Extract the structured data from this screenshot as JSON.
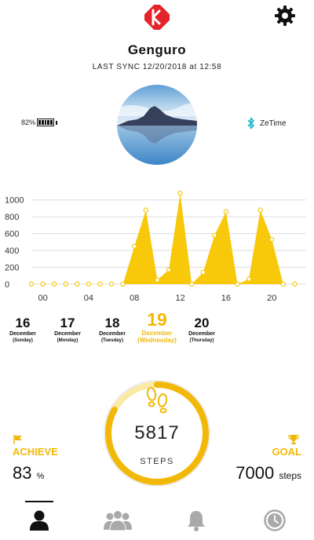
{
  "app": {
    "user_name": "Genguro",
    "last_sync": "LAST SYNC 12/20/2018 at 12:58",
    "brand_color": "#e5232b",
    "accent_color": "#f2b807"
  },
  "device": {
    "battery": "82%",
    "name": "ZeTime",
    "bluetooth_color": "#1cb5c8"
  },
  "chart_data": {
    "type": "area",
    "y_ticks": [
      "1000",
      "800",
      "600",
      "400",
      "200",
      "0"
    ],
    "x_ticks": [
      "00",
      "04",
      "08",
      "12",
      "16",
      "20"
    ],
    "ylim": [
      0,
      1100
    ],
    "xlim": [
      -1,
      23
    ],
    "x": [
      -1,
      0,
      1,
      2,
      3,
      4,
      5,
      6,
      7,
      8,
      9,
      10,
      11,
      12,
      13,
      14,
      15,
      16,
      17,
      18,
      19,
      20,
      21,
      22
    ],
    "values": [
      0,
      0,
      0,
      0,
      0,
      0,
      0,
      0,
      0,
      450,
      880,
      50,
      170,
      1080,
      0,
      140,
      580,
      860,
      0,
      60,
      880,
      530,
      0,
      0
    ],
    "series_color": "#f7c90a"
  },
  "days": [
    {
      "num": "16",
      "month": "December",
      "weekday": "(Sunday)",
      "active": false
    },
    {
      "num": "17",
      "month": "December",
      "weekday": "(Monday)",
      "active": false
    },
    {
      "num": "18",
      "month": "December",
      "weekday": "(Tuesday)",
      "active": false
    },
    {
      "num": "19",
      "month": "December",
      "weekday": "(Wednesday)",
      "active": true
    },
    {
      "num": "20",
      "month": "December",
      "weekday": "(Thursday)",
      "active": false
    }
  ],
  "steps": {
    "count": "5817",
    "label": "STEPS",
    "progress": 0.83
  },
  "achieve": {
    "title": "ACHIEVE",
    "value": "83",
    "unit": "%"
  },
  "goal": {
    "title": "GOAL",
    "value": "7000",
    "unit": "steps"
  },
  "tabs": [
    {
      "icon": "person-icon",
      "active": true
    },
    {
      "icon": "group-icon",
      "active": false
    },
    {
      "icon": "bell-icon",
      "active": false
    },
    {
      "icon": "watch-icon",
      "active": false
    }
  ]
}
